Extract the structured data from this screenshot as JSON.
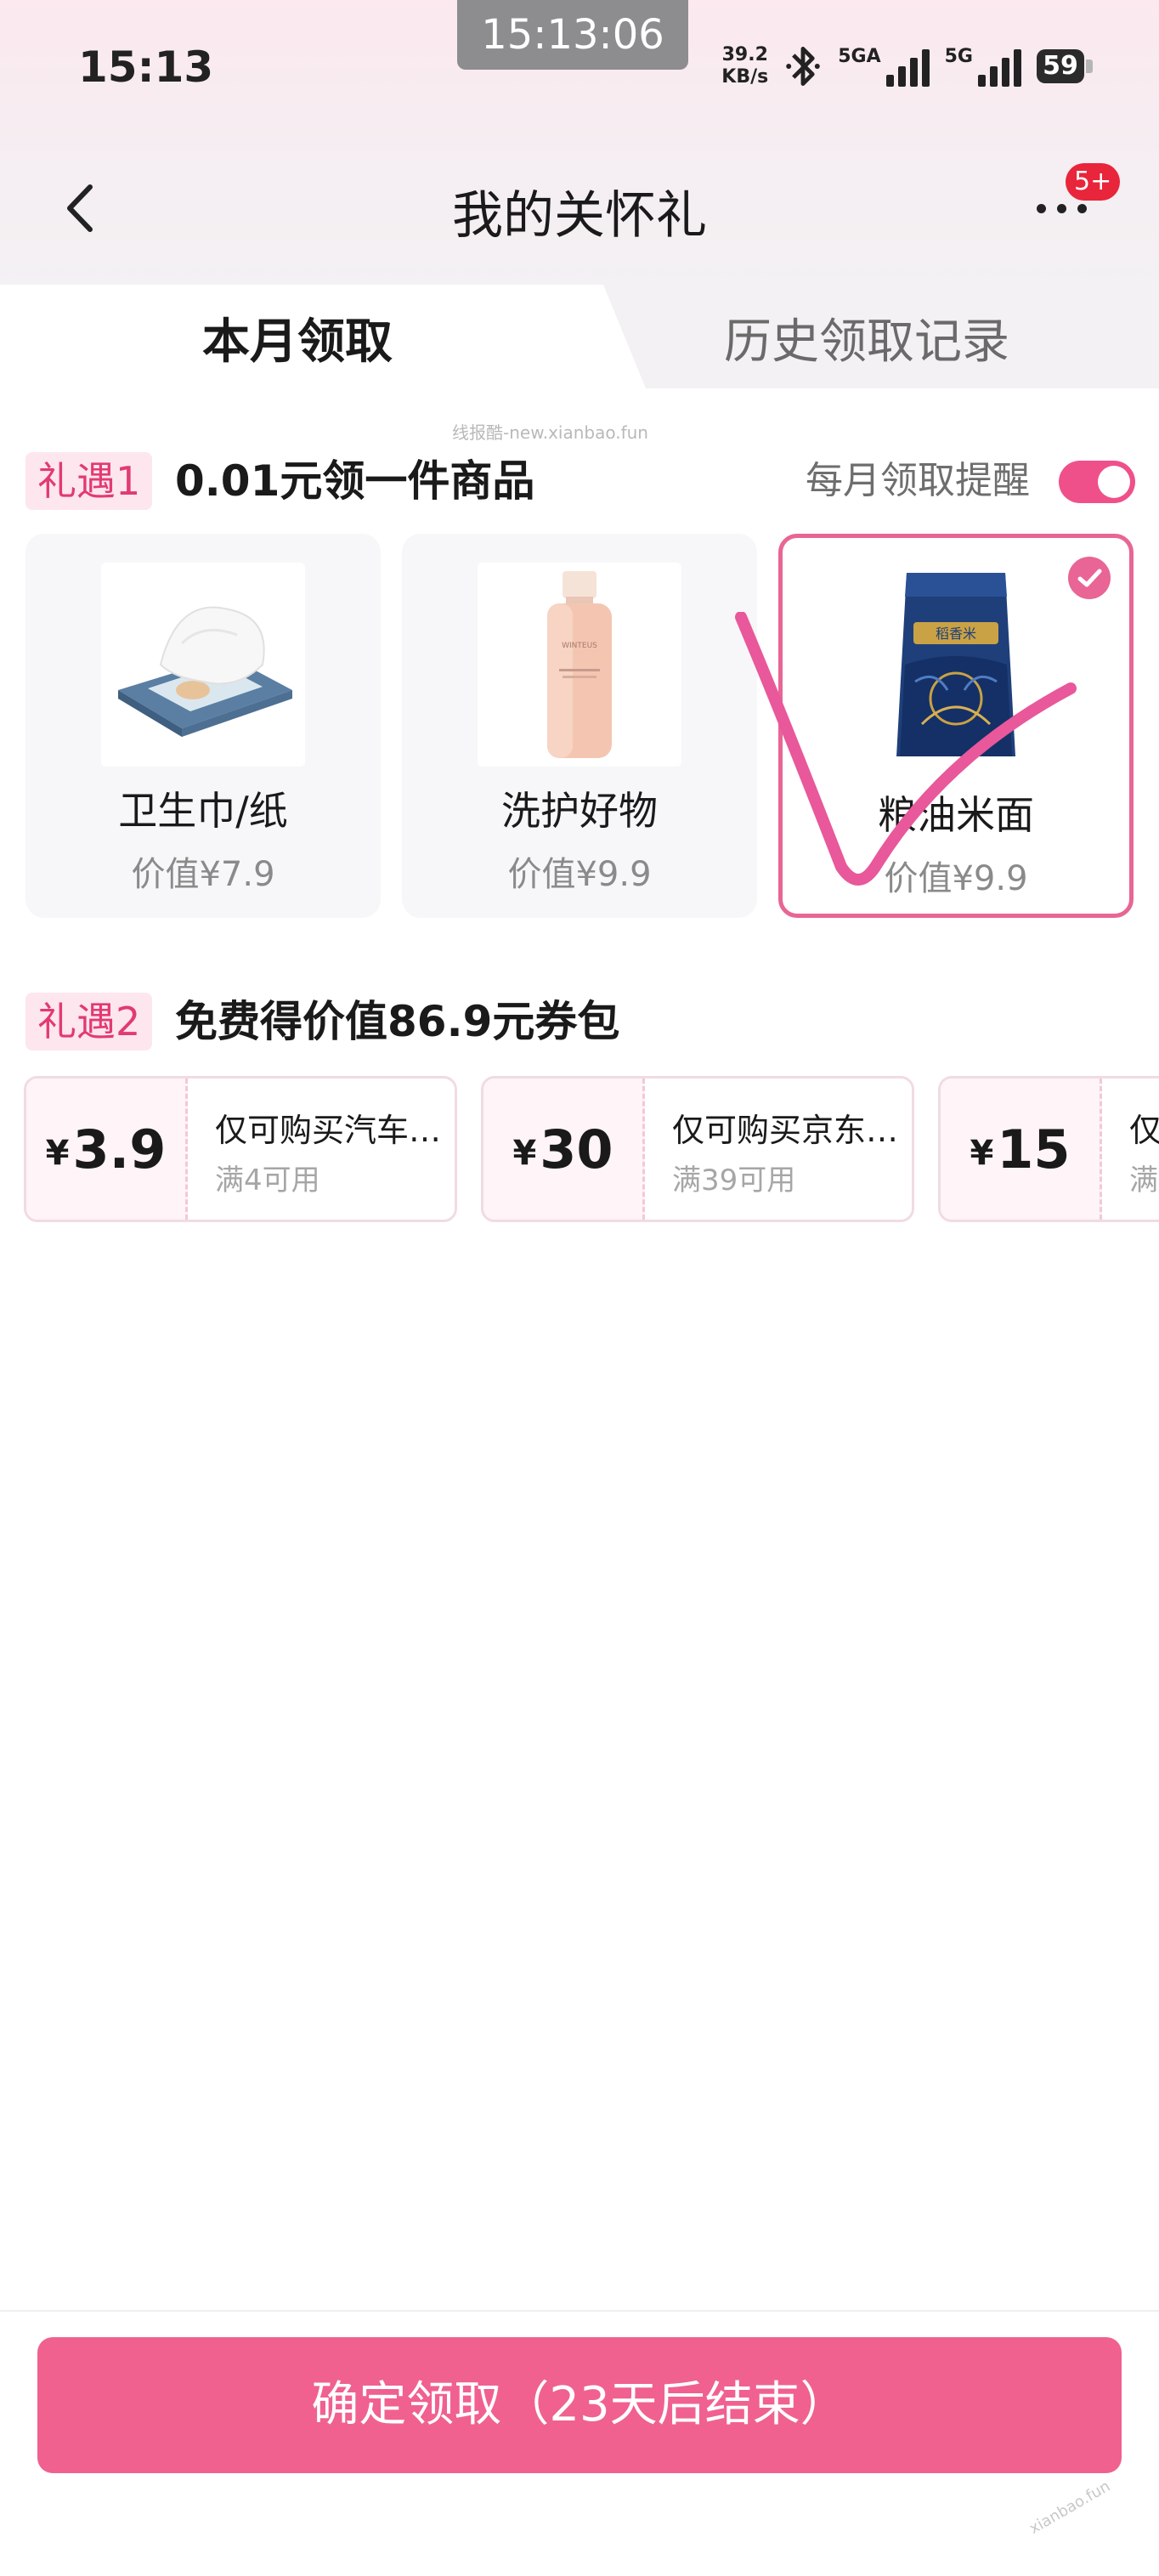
{
  "status_bar": {
    "time": "15:13",
    "clock_chip": "15:13:06",
    "net_speed_value": "39.2",
    "net_speed_unit": "KB/s",
    "sim1_label": "5GA",
    "sim2_label": "5G",
    "battery": "59"
  },
  "nav": {
    "title": "我的关怀礼",
    "badge": "5+"
  },
  "tabs": [
    {
      "label": "本月领取",
      "active": true
    },
    {
      "label": "历史领取记录",
      "active": false
    }
  ],
  "watermark": "线报酷-new.xianbao.fun",
  "gift1": {
    "tag": "礼遇1",
    "title": "0.01元领一件商品",
    "remind_label": "每月领取提醒",
    "remind_on": true,
    "items": [
      {
        "name": "卫生巾/纸",
        "price": "价值¥7.9",
        "selected": false
      },
      {
        "name": "洗护好物",
        "price": "价值¥9.9",
        "selected": false
      },
      {
        "name": "粮油米面",
        "price": "价值¥9.9",
        "selected": true
      }
    ]
  },
  "gift2": {
    "tag": "礼遇2",
    "title": "免费得价值86.9元券包",
    "coupons": [
      {
        "currency": "¥",
        "amount": "3.9",
        "desc": "仅可购买汽车…",
        "condition": "满4可用"
      },
      {
        "currency": "¥",
        "amount": "30",
        "desc": "仅可购买京东…",
        "condition": "满39可用"
      },
      {
        "currency": "¥",
        "amount": "15",
        "desc": "仅",
        "condition": "满"
      }
    ]
  },
  "confirm_button": "确定领取（23天后结束）",
  "colors": {
    "accent": "#f0618f",
    "tag_bg": "#fde6ee",
    "tag_text": "#e23a72",
    "selected_border": "#e86595"
  }
}
